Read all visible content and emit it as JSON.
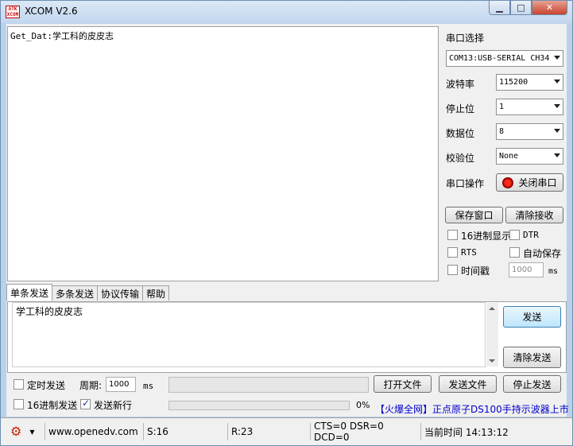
{
  "window": {
    "title": "XCOM V2.6",
    "logo_text": "ATK XCOM"
  },
  "receive": {
    "content": "Get_Dat:学工科的皮皮志"
  },
  "serial": {
    "port_label": "串口选择",
    "port_value": "COM13:USB-SERIAL CH34",
    "baud_label": "波特率",
    "baud_value": "115200",
    "stop_label": "停止位",
    "stop_value": "1",
    "data_label": "数据位",
    "data_value": "8",
    "parity_label": "校验位",
    "parity_value": "None",
    "op_label": "串口操作",
    "op_button": "关闭串口"
  },
  "actions": {
    "save_window": "保存窗口",
    "clear_recv": "清除接收"
  },
  "options": {
    "hex_display": "16进制显示",
    "dtr": "DTR",
    "rts": "RTS",
    "auto_save": "自动保存",
    "timestamp": "时间戳",
    "timestamp_value": "1000",
    "timestamp_unit": "ms"
  },
  "tabs": [
    "单条发送",
    "多条发送",
    "协议传输",
    "帮助"
  ],
  "send": {
    "content": "学工科的皮皮志",
    "send_button": "发送",
    "clear_button": "清除发送",
    "timed_send": "定时发送",
    "period_label": "周期:",
    "period_value": "1000",
    "period_unit": "ms",
    "open_file": "打开文件",
    "send_file": "发送文件",
    "stop_send": "停止发送",
    "hex_send": "16进制发送",
    "newline": "发送新行",
    "progress_percent": 0,
    "progress_text": "0%",
    "ad_text": "【火爆全网】正点原子DS100手持示波器上市"
  },
  "status": {
    "url": "www.openedv.com",
    "sent": "S:16",
    "received": "R:23",
    "lines": "CTS=0 DSR=0 DCD=0",
    "time": "当前时间 14:13:12"
  },
  "colors": {
    "ad_text": "#0000cc",
    "settings_gear": "#cc2200"
  }
}
